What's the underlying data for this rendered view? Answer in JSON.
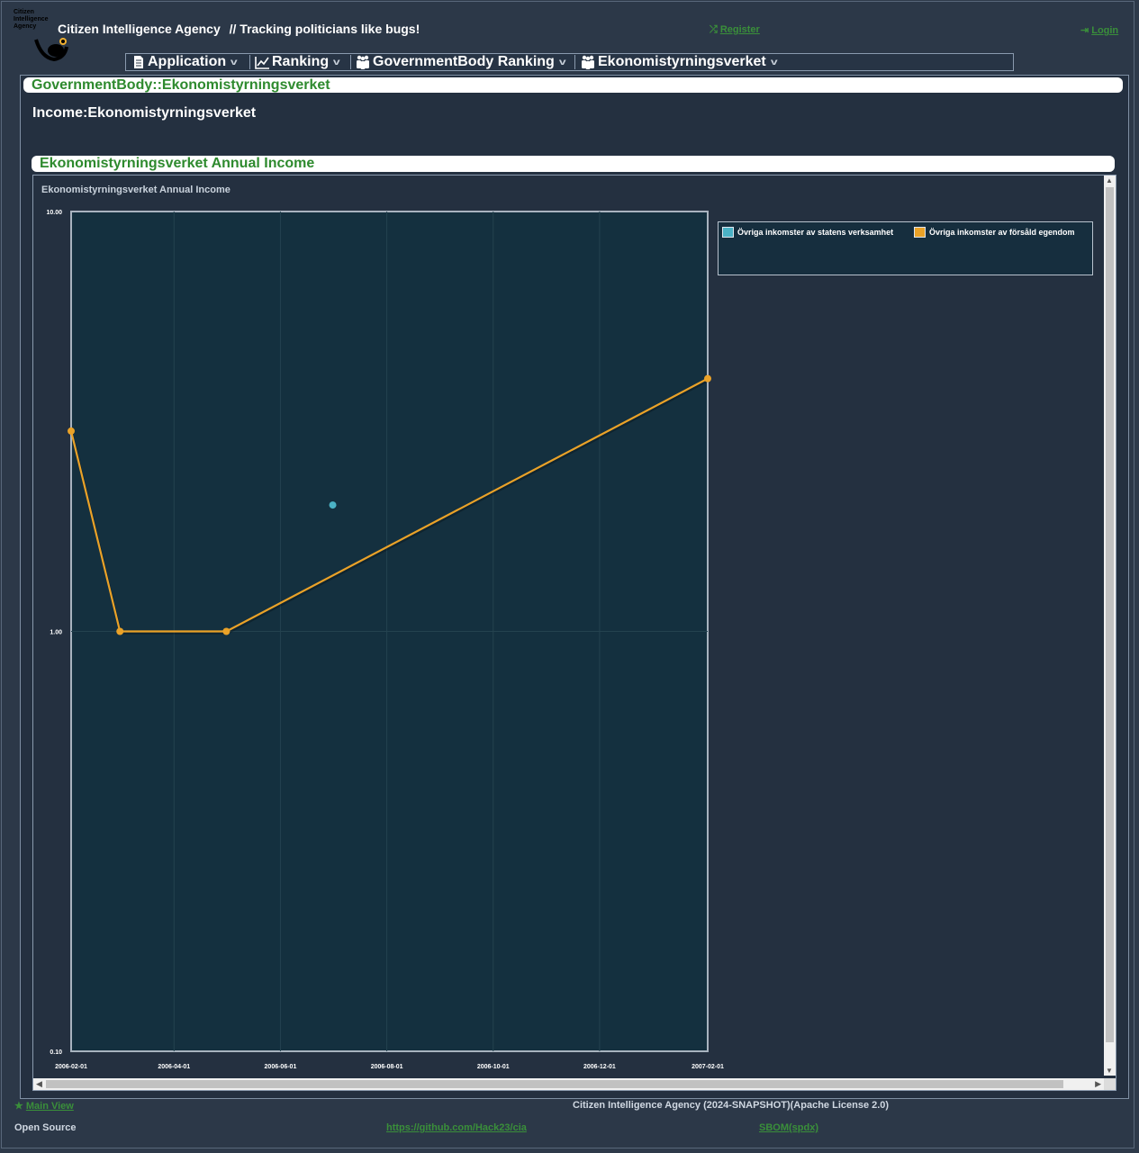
{
  "header": {
    "logo_text": "Citizen Intelligence Agency",
    "site_title": "Citizen Intelligence Agency",
    "tagline": "// Tracking politicians like bugs!",
    "register_label": "Register",
    "login_label": "Login"
  },
  "menu": {
    "items": [
      {
        "label": "Application",
        "icon": "document-icon"
      },
      {
        "label": "Ranking",
        "icon": "line-chart-icon"
      },
      {
        "label": "GovernmentBody Ranking",
        "icon": "group-icon"
      },
      {
        "label": "Ekonomistyrningsverket",
        "icon": "group-icon"
      }
    ]
  },
  "page": {
    "panel_title": "GovernmentBody::Ekonomistyrningsverket",
    "income_title": "Income:Ekonomistyrningsverket",
    "chart_panel_title": "Ekonomistyrningsverket Annual Income"
  },
  "colors": {
    "accent_green": "#2e8a2e",
    "series_blue": "#4bb2c5",
    "series_orange": "#eaa228",
    "plot_background": "#14303f"
  },
  "chart_data": {
    "type": "line",
    "title": "Ekonomistyrningsverket Annual Income",
    "y_scale": "log",
    "ylim": [
      0.1,
      10
    ],
    "y_ticks": [
      "10.00",
      "1.00",
      "0.10"
    ],
    "x_ticks": [
      "2006-02-01",
      "2006-04-01",
      "2006-06-01",
      "2006-08-01",
      "2006-10-01",
      "2006-12-01",
      "2007-02-01"
    ],
    "xlim": [
      "2006-02-01",
      "2007-02-01"
    ],
    "grid": true,
    "legend_placement": "right",
    "series": [
      {
        "name": "Övriga inkomster av statens verksamhet",
        "color": "#4bb2c5",
        "points": [
          {
            "x": "2006-07-01",
            "y": 2.0
          }
        ]
      },
      {
        "name": "Övriga inkomster av försåld egendom",
        "color": "#eaa228",
        "points": [
          {
            "x": "2006-02-01",
            "y": 3.0
          },
          {
            "x": "2006-03-01",
            "y": 1.0
          },
          {
            "x": "2006-05-01",
            "y": 1.0
          },
          {
            "x": "2007-02-01",
            "y": 4.0
          }
        ]
      }
    ]
  },
  "footer": {
    "main_view_label": "Main View",
    "version_text": "Citizen Intelligence Agency (2024-SNAPSHOT)(Apache License 2.0)",
    "open_source_label": "Open Source",
    "github_link": "https://github.com/Hack23/cia",
    "sbom_link": "SBOM(spdx)"
  }
}
